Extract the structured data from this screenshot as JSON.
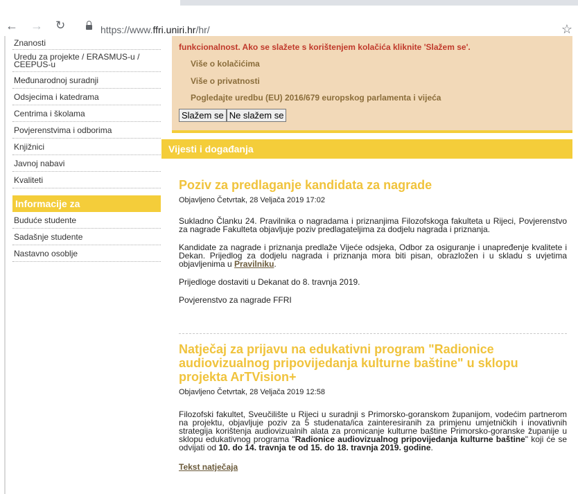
{
  "browser": {
    "url_scheme": "https://www.",
    "url_host": "ffri.uniri.hr",
    "url_path": "/hr/"
  },
  "sidebar": {
    "items": [
      {
        "label": "Znanosti"
      },
      {
        "label": "Uredu za projekte / ERASMUS-u / CEEPUS-u"
      },
      {
        "label": "Međunarodnoj suradnji"
      },
      {
        "label": "Odsjecima i katedrama"
      },
      {
        "label": "Centrima i školama"
      },
      {
        "label": "Povjerenstvima i odborima"
      },
      {
        "label": "Knjižnici"
      },
      {
        "label": "Javnoj nabavi"
      },
      {
        "label": "Kvaliteti"
      }
    ],
    "info_heading": "Informacije za",
    "info_items": [
      {
        "label": "Buduće studente"
      },
      {
        "label": "Sadašnje studente"
      },
      {
        "label": "Nastavno osoblje"
      }
    ]
  },
  "cookie_notice": {
    "text": "funkcionalnost. Ako se slažete s korištenjem kolačića kliknite 'Slažem se'.",
    "links": [
      "Više o kolačićima",
      "Više o privatnosti",
      "Pogledajte uredbu (EU) 2016/679 europskog parlamenta i vijeća"
    ],
    "accept_label": "Slažem se",
    "decline_label": "Ne slažem se"
  },
  "news_heading": "Vijesti i događanja",
  "articles": [
    {
      "title": "Poziv za predlaganje kandidata za nagrade",
      "date": "Objavljeno Četvrtak, 28 Veljača 2019 17:02",
      "p1": "Sukladno Članku 24. Pravilnika o nagradama i priznanjima Filozofskoga fakulteta u Rijeci, Povjerenstvo za nagrade Fakulteta objavljuje poziv predlagateljima za dodjelu nagrada i priznanja.",
      "p2_text": "Kandidate za nagrade i priznanja predlaže Vijeće odsjeka, Odbor za osiguranje i unapređenje kvalitete i Dekan. Prijedlog za dodjelu nagrada i priznanja mora biti pisan, obrazložen i u skladu s uvjetima objavljenima u ",
      "p2_link": "Pravilniku",
      "p2_end": ".",
      "p3": "Prijedloge dostaviti u Dekanat do 8. travnja 2019.",
      "p4": "Povjerenstvo za nagrade FFRI"
    },
    {
      "title": "Natječaj za prijavu na edukativni program \"Radionice audiovizualnog pripovijedanja kulturne baštine\" u sklopu projekta ArTVision+",
      "date": "Objavljeno Četvrtak, 28 Veljača 2019 12:58",
      "p1_a": "Filozofski fakultet, Sveučilište u Rijeci u suradnji s Primorsko-goranskom županijom, vodećim partnerom na projektu, objavljuje poziv za 5 studenata/ica zainteresiranih za primjenu umjetničkih i inovativnih strategija korištenja audiovizualnih alata za promicanje kulturne baštine Primorsko-goranske županije u sklopu edukativnog programa \"",
      "p1_bold": "Radionice audiovizualnog pripovijedanja kulturne baštine",
      "p1_b": "\" koji će se odvijati od ",
      "p1_bold2": "10. do 14. travnja te od 15. do 18. travnja 2019. godine",
      "p1_c": ".",
      "link": "Tekst natječaja"
    }
  ]
}
